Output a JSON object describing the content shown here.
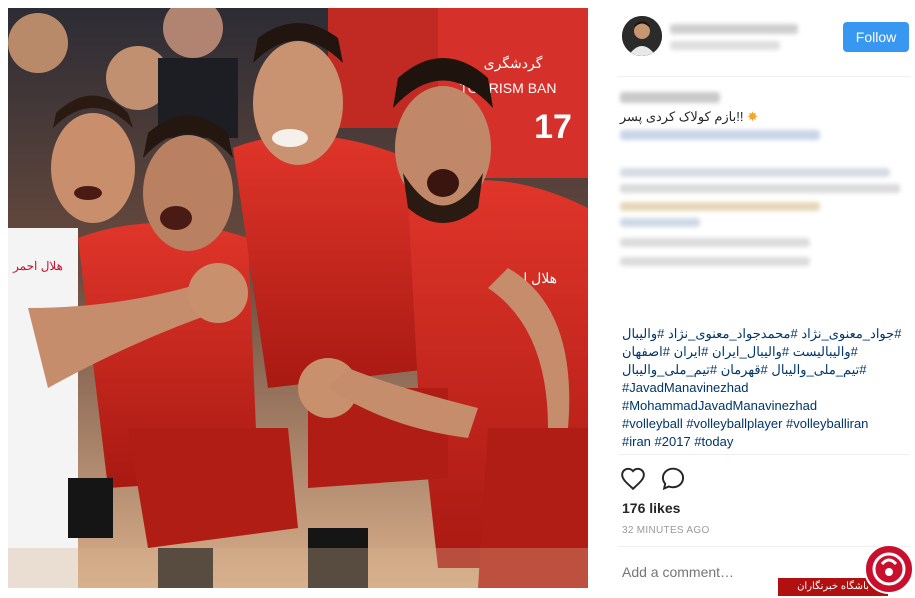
{
  "header": {
    "follow_label": "Follow"
  },
  "caption": {
    "text": "!!بازم کولاک کردی پسر"
  },
  "hashtags": [
    "#جواد_معنوی_نژاد #محمدجواد_معنوی_نژاد #والیبال",
    "#والیبالیست #والیبال_ایران #ایران #اصفهان",
    "#تیم_ملی_والیبال #قهرمان #تیم_ملی_والیبال",
    "#JavadManavinezhad",
    "#MohammadJavadManavinezhad",
    "#volleyball #volleyballplayer #volleyballiran",
    "#iran #2017 #today"
  ],
  "actions": {
    "like_icon": "heart-icon",
    "comment_icon": "comment-bubble-icon"
  },
  "likes": "176 likes",
  "timestamp": "32 MINUTES AGO",
  "comment_input": {
    "placeholder": "Add a comment…"
  },
  "photo": {
    "jersey_text_left": "هلال احمر",
    "jersey_text_right": "هلال احمر",
    "banner_text": "TOURISM BAN",
    "banner_text_fa": "گردشگری",
    "jersey_number": "17"
  },
  "watermark": {
    "label": "باشگاه خبرنگاران"
  },
  "colors": {
    "follow_button": "#3897f0",
    "hashtag": "#003569",
    "jersey_red": "#d3281f"
  }
}
